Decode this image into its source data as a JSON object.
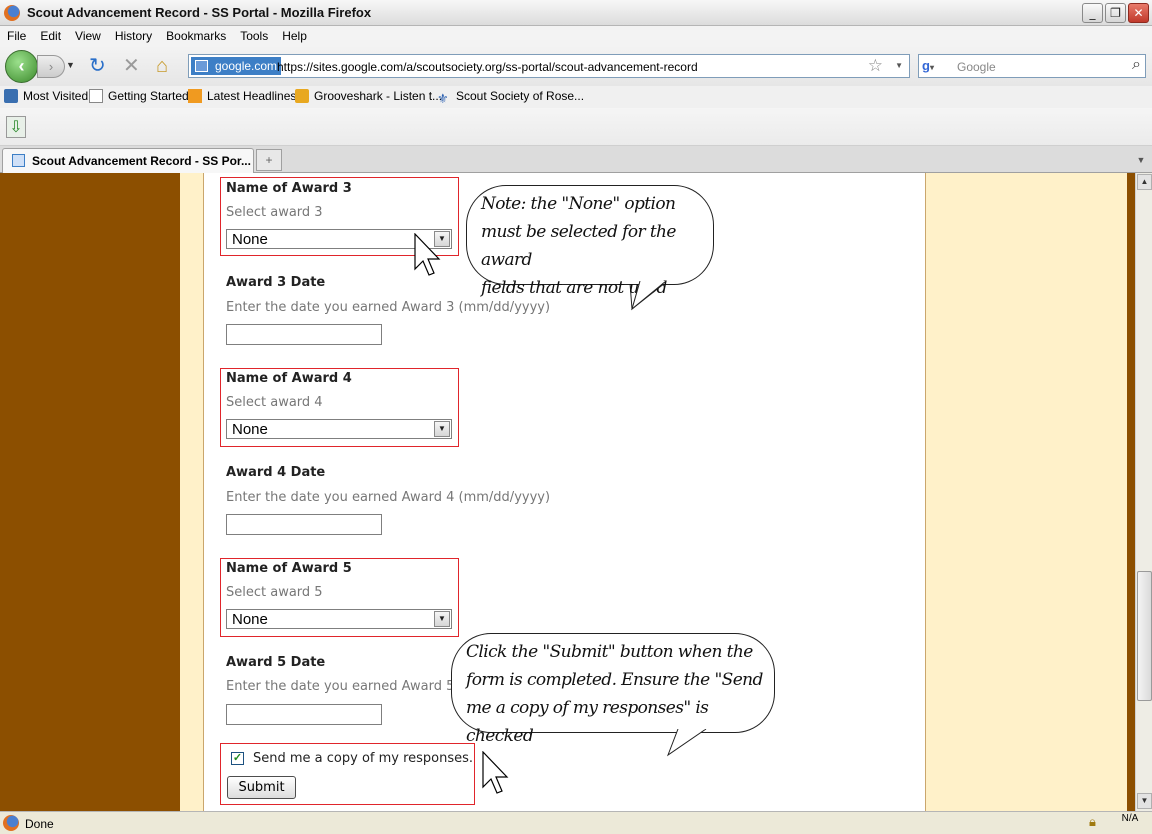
{
  "window": {
    "title": "Scout Advancement Record - SS Portal - Mozilla Firefox"
  },
  "menu": [
    "File",
    "Edit",
    "View",
    "History",
    "Bookmarks",
    "Tools",
    "Help"
  ],
  "navigation": {
    "site_identity": "google.com",
    "url": "https://sites.google.com/a/scoutsociety.org/ss-portal/scout-advancement-record",
    "search_placeholder": "Google"
  },
  "bookmarks": [
    "Most Visited",
    "Getting Started",
    "Latest Headlines",
    "Grooveshark - Listen t...",
    "Scout Society of Rose..."
  ],
  "tab": {
    "title": "Scout Advancement Record - SS Por..."
  },
  "form": {
    "award3": {
      "name_label": "Name of Award 3",
      "name_hint": "Select award 3",
      "selected": "None",
      "date_label": "Award 3 Date",
      "date_hint": "Enter the date you earned Award 3 (mm/dd/yyyy)",
      "date_value": ""
    },
    "award4": {
      "name_label": "Name of Award 4",
      "name_hint": "Select award 4",
      "selected": "None",
      "date_label": "Award 4 Date",
      "date_hint": "Enter the date you earned Award 4 (mm/dd/yyyy)",
      "date_value": ""
    },
    "award5": {
      "name_label": "Name of Award 5",
      "name_hint": "Select award 5",
      "selected": "None",
      "date_label": "Award 5 Date",
      "date_hint": "Enter the date you earned Award 5",
      "date_value": ""
    },
    "send_copy_label": "Send me a copy of my responses.",
    "send_copy_checked": true,
    "submit_label": "Submit"
  },
  "callouts": {
    "note_lines": [
      "Note: the \"None\" option",
      "must be selected for the award",
      "fields that are not used"
    ],
    "submit_lines": [
      "Click the \"Submit\" button when the",
      "form is completed. Ensure the \"Send",
      "me a copy of my responses\" is checked"
    ]
  },
  "status": {
    "text": "Done",
    "zoom": "N/A"
  },
  "colors": {
    "sidebar_brown": "#8c4f00",
    "cream": "#fff1c9",
    "highlight_red": "#e0252b"
  }
}
